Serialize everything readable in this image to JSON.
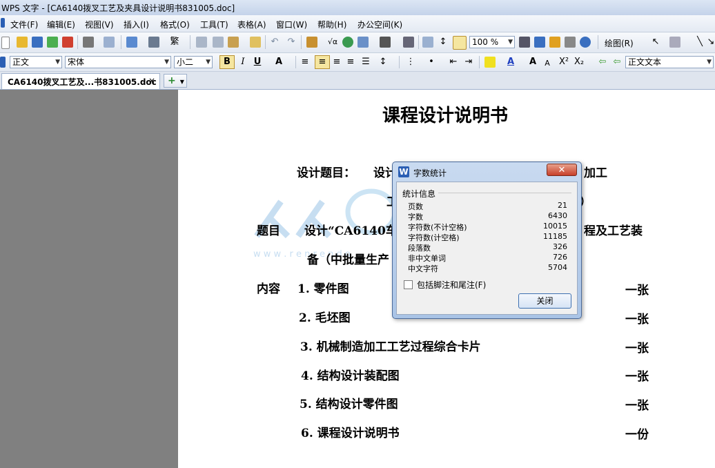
{
  "window": {
    "title": "WPS 文字 - [CA6140拨叉工艺及夹具设计说明书831005.doc]"
  },
  "menu": [
    "文件(F)",
    "编辑(E)",
    "视图(V)",
    "插入(I)",
    "格式(O)",
    "工具(T)",
    "表格(A)",
    "窗口(W)",
    "帮助(H)",
    "办公空间(K)"
  ],
  "toolbar": {
    "zoom": "100 %",
    "draw_label": "绘图(R)"
  },
  "format_bar": {
    "style": "正文",
    "font": "宋体",
    "size": "小二",
    "bold": "B",
    "italic": "I",
    "underline": "U",
    "style_right": "正文文本"
  },
  "tabs": {
    "doc_tab": "CA6140拨叉工艺及...书831005.doc",
    "close": "×",
    "add": "+"
  },
  "document": {
    "title": "课程设计说明书",
    "design_label": "设计题目：",
    "design_partial": "设计",
    "design_tail": "加工",
    "line2_dash": "工",
    "line2_paren": "）",
    "topic_label": "题目",
    "topic_text": "设计“CA6140车",
    "topic_tail": "程及工艺装",
    "topic_line2": "备（中批量生产",
    "content_label": "内容",
    "items": [
      {
        "text": "1. 零件图",
        "qty": "一张"
      },
      {
        "text": "2. 毛坯图",
        "qty": "一张"
      },
      {
        "text": "3. 机械制造加工工艺过程综合卡片",
        "qty": "一张"
      },
      {
        "text": "4. 结构设计装配图",
        "qty": "一张"
      },
      {
        "text": "5. 结构设计零件图",
        "qty": "一张"
      },
      {
        "text": "6.  课程设计说明书",
        "qty": "一份"
      }
    ],
    "watermark_url": "w w w . r e n r e n d o"
  },
  "dialog": {
    "title": "字数统计",
    "group": "统计信息",
    "stats": [
      {
        "label": "页数",
        "value": "21"
      },
      {
        "label": "字数",
        "value": "6430"
      },
      {
        "label": "字符数(不计空格)",
        "value": "10015"
      },
      {
        "label": "字符数(计空格)",
        "value": "11185"
      },
      {
        "label": "段落数",
        "value": "326"
      },
      {
        "label": "非中文单词",
        "value": "726"
      },
      {
        "label": "中文字符",
        "value": "5704"
      }
    ],
    "checkbox_label": "包括脚注和尾注(F)",
    "close_button": "关闭"
  },
  "colors": {
    "accent": "#2b5fb4",
    "close_red": "#c8402a"
  }
}
